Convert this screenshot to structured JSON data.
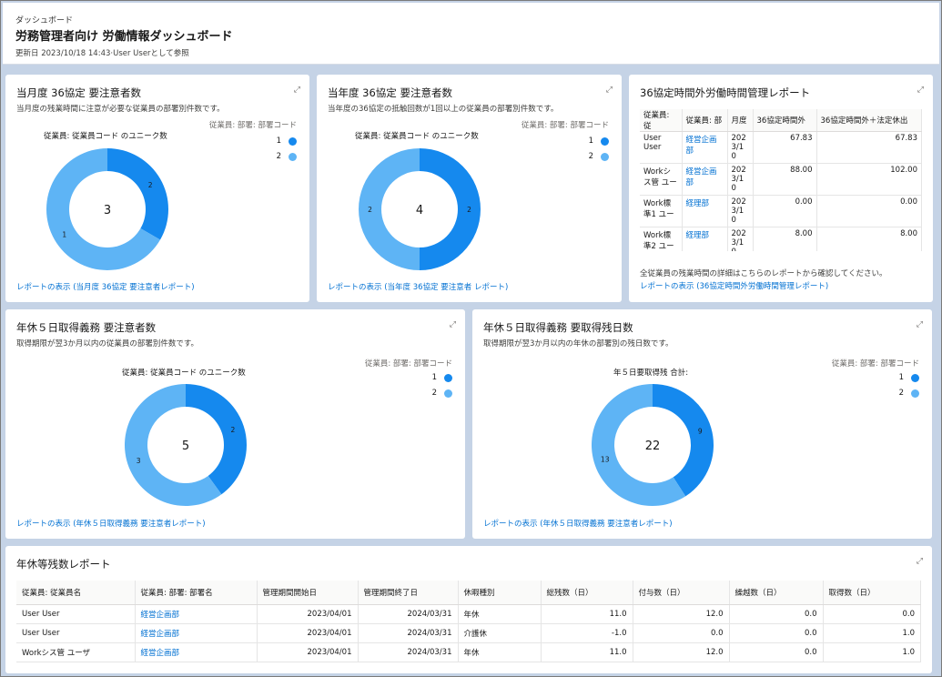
{
  "header": {
    "crumb": "ダッシュボード",
    "title": "労務管理者向け 労働情報ダッシュボード",
    "meta": "更新日 2023/10/18 14:43·User Userとして参照"
  },
  "colors": {
    "series1": "#1589ee",
    "series2": "#5eb4f5"
  },
  "cards": {
    "c1": {
      "title": "当月度 36協定 要注意者数",
      "desc": "当月度の残業時間に注意が必要な従業員の部署別件数です。",
      "chart_title": "従業員: 従業員コード のユニーク数",
      "legend_title": "従業員: 部署: 部署コード",
      "legend": [
        "1",
        "2"
      ],
      "center": "3",
      "labels": [
        "2",
        "1"
      ],
      "link": "レポートの表示 (当月度 36協定 要注意者レポート)"
    },
    "c2": {
      "title": "当年度 36協定 要注意者数",
      "desc": "当年度の36協定の抵触回数が1回以上の従業員の部署別件数です。",
      "chart_title": "従業員: 従業員コード のユニーク数",
      "legend_title": "従業員: 部署: 部署コード",
      "legend": [
        "1",
        "2"
      ],
      "center": "4",
      "labels": [
        "2",
        "2"
      ],
      "link": "レポートの表示 (当年度 36協定 要注意者 レポート)"
    },
    "c3": {
      "title": "36協定時間外労働時間管理レポート",
      "headers": [
        "従業員: 従",
        "従業員: 部",
        "月度",
        "36協定時間外",
        "36協定時間外＋法定休出"
      ],
      "rows": [
        [
          "User User",
          "経営企画部",
          "2023/10",
          "67.83",
          "67.83"
        ],
        [
          "Workシス管 ユー",
          "経営企画部",
          "2023/10",
          "88.00",
          "102.00"
        ],
        [
          "Work標準1 ユー",
          "経理部",
          "2023/10",
          "0.00",
          "0.00"
        ],
        [
          "Work標準2 ユー",
          "経理部",
          "2023/10",
          "8.00",
          "8.00"
        ]
      ],
      "note": "全従業員の残業時間の詳細はこちらのレポートから確認してください。",
      "link": "レポートの表示 (36協定時間外労働時間管理レポート)"
    },
    "c4": {
      "title": "年休５日取得義務 要注意者数",
      "desc": "取得期限が翌3か月以内の従業員の部署別件数です。",
      "chart_title": "従業員: 従業員コード のユニーク数",
      "legend_title": "従業員: 部署: 部署コード",
      "legend": [
        "1",
        "2"
      ],
      "center": "5",
      "labels": [
        "2",
        "3"
      ],
      "link": "レポートの表示 (年休５日取得義務 要注意者レポート)"
    },
    "c5": {
      "title": "年休５日取得義務 要取得残日数",
      "desc": "取得期限が翌3か月以内の年休の部署別の残日数です。",
      "chart_title": "年５日要取得残 合計:",
      "legend_title": "従業員: 部署: 部署コード",
      "legend": [
        "1",
        "2"
      ],
      "center": "22",
      "labels": [
        "9",
        "13"
      ],
      "link": "レポートの表示 (年休５日取得義務 要注意者レポート)"
    },
    "c6": {
      "title": "年休等残数レポート",
      "headers": [
        "従業員: 従業員名",
        "従業員: 部署: 部署名",
        "管理期間開始日",
        "管理期間終了日",
        "休暇種別",
        "総残数（日）",
        "付与数（日）",
        "繰越数（日）",
        "取得数（日）"
      ],
      "rows": [
        [
          "User User",
          "経営企画部",
          "2023/04/01",
          "2024/03/31",
          "年休",
          "11.0",
          "12.0",
          "0.0",
          "0.0"
        ],
        [
          "User User",
          "経営企画部",
          "2023/04/01",
          "2024/03/31",
          "介護休",
          "-1.0",
          "0.0",
          "0.0",
          "1.0"
        ],
        [
          "Workシス管 ユーザ",
          "経営企画部",
          "2023/04/01",
          "2024/03/31",
          "年休",
          "11.0",
          "12.0",
          "0.0",
          "1.0"
        ]
      ]
    }
  },
  "chart_data": [
    {
      "type": "pie",
      "title": "当月度 36協定 要注意者数",
      "categories": [
        "1",
        "2"
      ],
      "values": [
        1,
        2
      ],
      "total": 3
    },
    {
      "type": "pie",
      "title": "当年度 36協定 要注意者数",
      "categories": [
        "1",
        "2"
      ],
      "values": [
        2,
        2
      ],
      "total": 4
    },
    {
      "type": "pie",
      "title": "年休５日取得義務 要注意者数",
      "categories": [
        "1",
        "2"
      ],
      "values": [
        2,
        3
      ],
      "total": 5
    },
    {
      "type": "pie",
      "title": "年休５日取得義務 要取得残日数",
      "categories": [
        "1",
        "2"
      ],
      "values": [
        9,
        13
      ],
      "total": 22
    }
  ]
}
